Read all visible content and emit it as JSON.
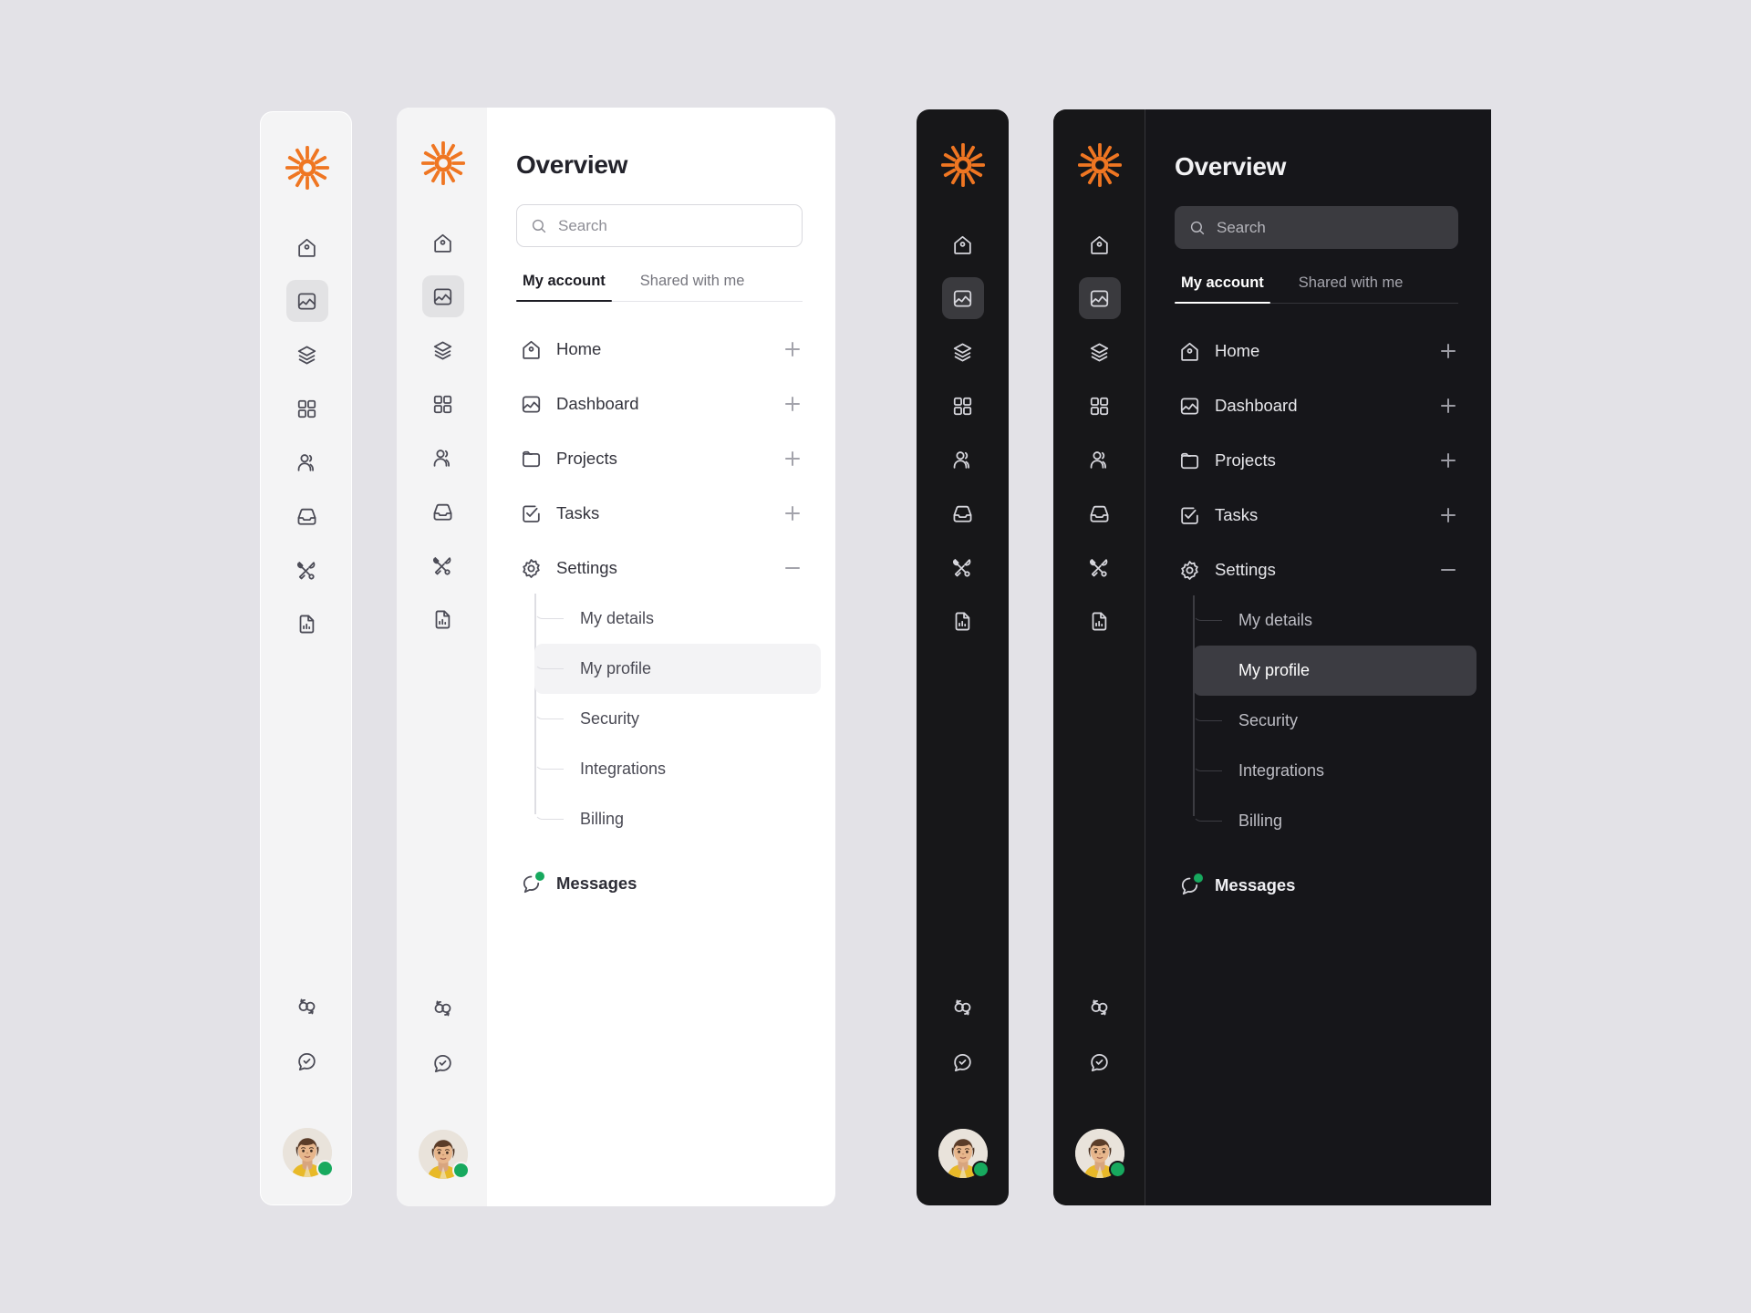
{
  "theme": {
    "page_background": "#e3e2e7",
    "light_panel_bg": "#ffffff",
    "light_rail_bg": "#f4f4f5",
    "dark_panel_bg": "#16161a",
    "dark_rail_bg": "#171719",
    "brand_orange": "#ef7622",
    "online_green": "#17a95e",
    "active_light": "#e2e2e4",
    "active_dark": "#3a3a3e"
  },
  "header": {
    "title": "Overview"
  },
  "search": {
    "placeholder": "Search",
    "icon": "search-icon"
  },
  "tabs": [
    {
      "label": "My account",
      "active": true
    },
    {
      "label": "Shared with me",
      "active": false
    }
  ],
  "rail": {
    "logo_icon": "sunburst-logo-icon",
    "items": [
      {
        "icon": "home-icon",
        "name": "home",
        "active": false
      },
      {
        "icon": "dashboard-image-icon",
        "name": "dashboard",
        "active": true
      },
      {
        "icon": "layers-icon",
        "name": "layers",
        "active": false
      },
      {
        "icon": "grid-icon",
        "name": "grid",
        "active": false
      },
      {
        "icon": "users-icon",
        "name": "users",
        "active": false
      },
      {
        "icon": "inbox-icon",
        "name": "inbox",
        "active": false
      },
      {
        "icon": "tools-icon",
        "name": "tools",
        "active": false
      },
      {
        "icon": "report-document-icon",
        "name": "reports",
        "active": false
      }
    ],
    "bottom_items": [
      {
        "icon": "transfer-circles-icon",
        "name": "transfer"
      },
      {
        "icon": "chat-check-icon",
        "name": "support"
      }
    ],
    "avatar": {
      "name": "avatar",
      "status": "online"
    }
  },
  "menu": {
    "items": [
      {
        "label": "Home",
        "icon": "home-icon",
        "expander": "plus"
      },
      {
        "label": "Dashboard",
        "icon": "dashboard-image-icon",
        "expander": "plus"
      },
      {
        "label": "Projects",
        "icon": "folder-icon",
        "expander": "plus"
      },
      {
        "label": "Tasks",
        "icon": "task-check-icon",
        "expander": "plus"
      },
      {
        "label": "Settings",
        "icon": "gear-icon",
        "expander": "minus"
      }
    ],
    "sub_items": [
      {
        "label": "My details",
        "active": false
      },
      {
        "label": "My profile",
        "active": true
      },
      {
        "label": "Security",
        "active": false
      },
      {
        "label": "Integrations",
        "active": false
      },
      {
        "label": "Billing",
        "active": false
      }
    ],
    "messages": {
      "label": "Messages",
      "icon": "chat-icon",
      "has_unread": true
    }
  }
}
